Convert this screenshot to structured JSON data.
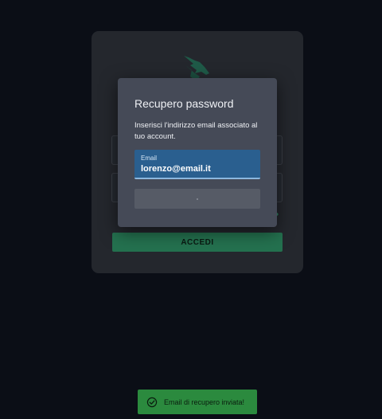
{
  "login": {
    "forgot_link": "?",
    "submit_label": "ACCEDI"
  },
  "modal": {
    "title": "Recupero password",
    "description": "Inserisci l'indirizzo email associato al tuo account.",
    "email_label": "Email",
    "email_value": "lorenzo@email.it"
  },
  "toast": {
    "message": "Email di recupero inviata!"
  },
  "colors": {
    "accent": "#24714f",
    "input_active": "#2a5f8f",
    "toast": "#2b8a3e"
  },
  "icons": {
    "logo": "dragon-logo-icon",
    "toast": "check-circle-icon"
  }
}
